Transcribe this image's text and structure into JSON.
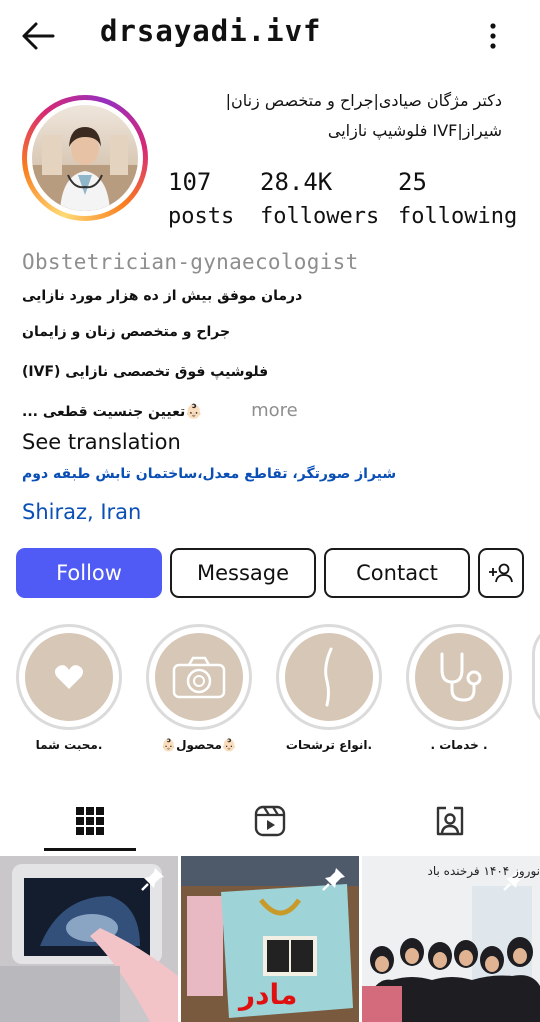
{
  "header": {
    "username": "drsayadi.ivf",
    "back_icon": "arrow-left-icon",
    "more_icon": "more-vertical-icon"
  },
  "profile": {
    "full_name": "دکتر مژگان صیادی|جراح و متخصص زنان| شیراز|IVF فلوشیپ نازایی",
    "stats": {
      "posts": {
        "value": "107",
        "label": "posts"
      },
      "followers": {
        "value": "28.4K",
        "label": "followers"
      },
      "following": {
        "value": "25",
        "label": "following"
      }
    },
    "category": "Obstetrician-gynaecologist",
    "bio": {
      "line1": "درمان موفق بیش از ده هزار مورد نازایی",
      "line2": "جراح و متخصص زنان و زایمان",
      "line3": "فلوشیپ فوق تخصصی نازایی (IVF)",
      "line4": "👶🏻تعیین جنسیت قطعی ...",
      "more": "more"
    },
    "see_translation": "See translation",
    "address": "شیراز صورتگر، تقاطع معدل،ساختمان تابش طبقه دوم",
    "location": "Shiraz, Iran"
  },
  "actions": {
    "follow": "Follow",
    "message": "Message",
    "contact": "Contact",
    "add_user_icon": "add-user-icon"
  },
  "highlights": [
    {
      "label": ".محبت شما",
      "icon": "heart-icon"
    },
    {
      "label": "👶🏻محصول👶🏻",
      "icon": "camera-icon"
    },
    {
      "label": ".انواع ترشحات",
      "icon": "uterus-line-icon"
    },
    {
      "label": ". خدمات .",
      "icon": "stethoscope-icon"
    }
  ],
  "tabs": [
    {
      "name": "posts",
      "icon": "grid-icon"
    },
    {
      "name": "reels",
      "icon": "reels-icon"
    },
    {
      "name": "tagged",
      "icon": "tagged-person-icon"
    }
  ],
  "posts": [
    {
      "caption": "",
      "pinned": true
    },
    {
      "caption": "مادر",
      "pinned": true
    },
    {
      "caption": "نوروز ۱۴۰۴ فرخنده باد",
      "pinned": true
    }
  ],
  "colors": {
    "follow_button": "#4f5bf4",
    "link": "#0a4fb5",
    "secondary_text": "#8e8e8e",
    "highlight_fill": "#d6c7b7"
  }
}
